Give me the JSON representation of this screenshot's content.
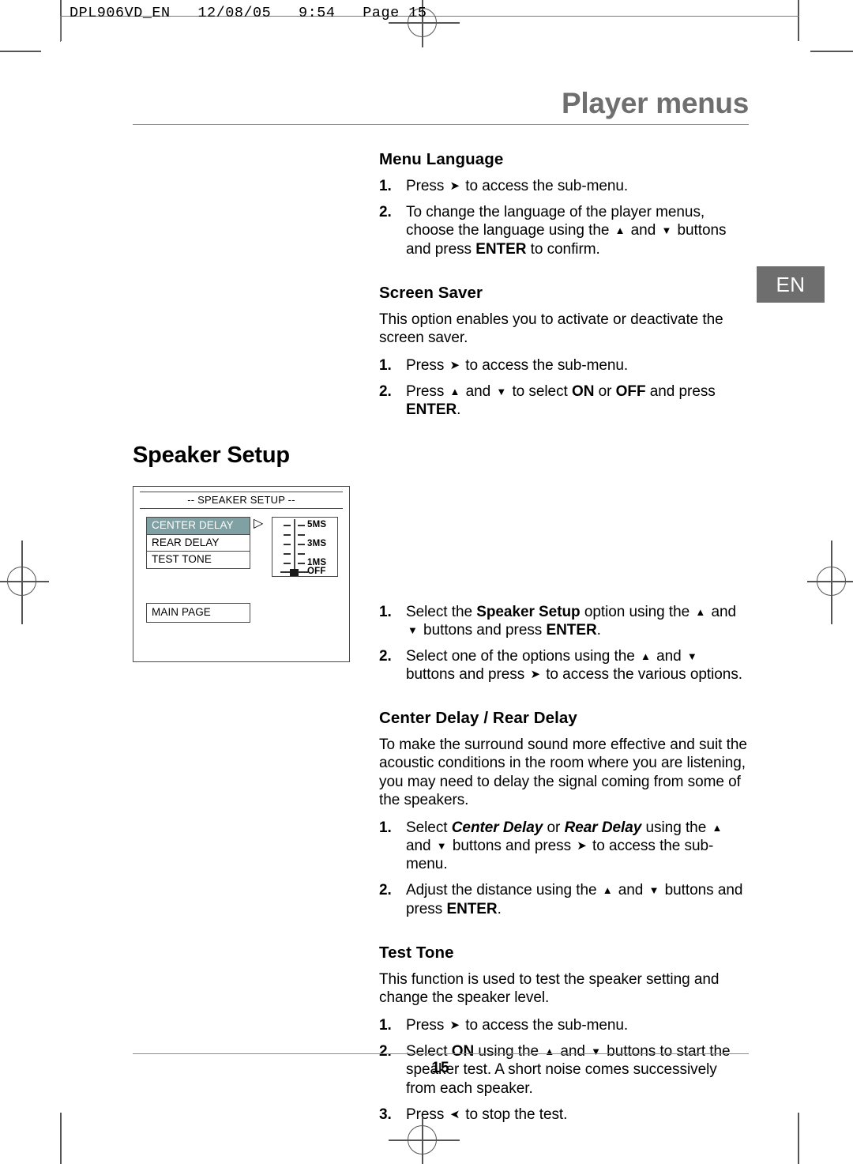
{
  "print_slug": "DPL906VD_EN   12/08/05   9:54   Page 15",
  "header": {
    "chapter_title": "Player menus"
  },
  "language_tab": {
    "label": "EN",
    "bg_color": "#6e6e6e",
    "text_color": "#ffffff"
  },
  "footer": {
    "page_number": "15"
  },
  "glyphs": {
    "right": "➤",
    "left": "➤",
    "up": "▲",
    "down": "▼"
  },
  "sections": {
    "menu_language": {
      "heading": "Menu Language",
      "steps": [
        {
          "num": "1.",
          "parts": [
            {
              "t": "Press ",
              "s": "n"
            },
            {
              "t": "right-arrow",
              "s": "arrow-right"
            },
            {
              "t": " to access the sub-menu.",
              "s": "n"
            }
          ]
        },
        {
          "num": "2.",
          "parts": [
            {
              "t": "To change the language of the player menus, choose the language using the ",
              "s": "n"
            },
            {
              "t": "up-arrow",
              "s": "arrow-up"
            },
            {
              "t": " and ",
              "s": "n"
            },
            {
              "t": "down-arrow",
              "s": "arrow-down"
            },
            {
              "t": " buttons and press ",
              "s": "n"
            },
            {
              "t": "ENTER",
              "s": "b"
            },
            {
              "t": " to confirm.",
              "s": "n"
            }
          ]
        }
      ]
    },
    "screen_saver": {
      "heading": "Screen Saver",
      "intro": "This option enables you to activate or deactivate the screen saver.",
      "steps": [
        {
          "num": "1.",
          "parts": [
            {
              "t": "Press ",
              "s": "n"
            },
            {
              "t": "right-arrow",
              "s": "arrow-right"
            },
            {
              "t": " to access the sub-menu.",
              "s": "n"
            }
          ]
        },
        {
          "num": "2.",
          "parts": [
            {
              "t": "Press ",
              "s": "n"
            },
            {
              "t": "up-arrow",
              "s": "arrow-up"
            },
            {
              "t": " and ",
              "s": "n"
            },
            {
              "t": "down-arrow",
              "s": "arrow-down"
            },
            {
              "t": " to select ",
              "s": "n"
            },
            {
              "t": "ON",
              "s": "b"
            },
            {
              "t": " or ",
              "s": "n"
            },
            {
              "t": "OFF",
              "s": "b"
            },
            {
              "t": " and press ",
              "s": "n"
            },
            {
              "t": "ENTER",
              "s": "b"
            },
            {
              "t": ".",
              "s": "n"
            }
          ]
        }
      ]
    },
    "speaker_setup": {
      "heading": "Speaker Setup",
      "steps": [
        {
          "num": "1.",
          "parts": [
            {
              "t": "Select the ",
              "s": "n"
            },
            {
              "t": "Speaker Setup",
              "s": "b"
            },
            {
              "t": " option using the ",
              "s": "n"
            },
            {
              "t": "up-arrow",
              "s": "arrow-up"
            },
            {
              "t": " and ",
              "s": "n"
            },
            {
              "t": "down-arrow",
              "s": "arrow-down"
            },
            {
              "t": " buttons and press ",
              "s": "n"
            },
            {
              "t": "ENTER",
              "s": "b"
            },
            {
              "t": ".",
              "s": "n"
            }
          ]
        },
        {
          "num": "2.",
          "parts": [
            {
              "t": "Select one of the options using the ",
              "s": "n"
            },
            {
              "t": "up-arrow",
              "s": "arrow-up"
            },
            {
              "t": " and ",
              "s": "n"
            },
            {
              "t": "down-arrow",
              "s": "arrow-down"
            },
            {
              "t": " buttons and press ",
              "s": "n"
            },
            {
              "t": "right-arrow",
              "s": "arrow-right"
            },
            {
              "t": " to access the various options.",
              "s": "n"
            }
          ]
        }
      ]
    },
    "center_rear_delay": {
      "heading": "Center Delay / Rear Delay",
      "intro": "To make the surround sound more effective and suit the acoustic conditions in the room where you are listening, you may need to delay the signal coming from some of the speakers.",
      "steps": [
        {
          "num": "1.",
          "parts": [
            {
              "t": "Select ",
              "s": "n"
            },
            {
              "t": "Center Delay",
              "s": "bi"
            },
            {
              "t": " or ",
              "s": "n"
            },
            {
              "t": "Rear Delay",
              "s": "bi"
            },
            {
              "t": " using the ",
              "s": "n"
            },
            {
              "t": "up-arrow",
              "s": "arrow-up"
            },
            {
              "t": " and ",
              "s": "n"
            },
            {
              "t": "down-arrow",
              "s": "arrow-down"
            },
            {
              "t": " buttons and press ",
              "s": "n"
            },
            {
              "t": "right-arrow",
              "s": "arrow-right"
            },
            {
              "t": " to access the sub-menu.",
              "s": "n"
            }
          ]
        },
        {
          "num": "2.",
          "parts": [
            {
              "t": "Adjust the distance using the ",
              "s": "n"
            },
            {
              "t": "up-arrow",
              "s": "arrow-up"
            },
            {
              "t": " and ",
              "s": "n"
            },
            {
              "t": "down-arrow",
              "s": "arrow-down"
            },
            {
              "t": " buttons and press ",
              "s": "n"
            },
            {
              "t": "ENTER",
              "s": "b"
            },
            {
              "t": ".",
              "s": "n"
            }
          ]
        }
      ]
    },
    "test_tone": {
      "heading": "Test Tone",
      "intro": "This function is used to test the speaker setting and change the speaker level.",
      "steps": [
        {
          "num": "1.",
          "parts": [
            {
              "t": "Press ",
              "s": "n"
            },
            {
              "t": "right-arrow",
              "s": "arrow-right"
            },
            {
              "t": " to access the sub-menu.",
              "s": "n"
            }
          ]
        },
        {
          "num": "2.",
          "parts": [
            {
              "t": "Select ",
              "s": "n"
            },
            {
              "t": "ON",
              "s": "b"
            },
            {
              "t": " using the ",
              "s": "n"
            },
            {
              "t": "up-arrow",
              "s": "arrow-up"
            },
            {
              "t": " and ",
              "s": "n"
            },
            {
              "t": "down-arrow",
              "s": "arrow-down"
            },
            {
              "t": " buttons to start the speaker test. A short noise comes successively from each speaker.",
              "s": "n"
            }
          ]
        },
        {
          "num": "3.",
          "parts": [
            {
              "t": "Press ",
              "s": "n"
            },
            {
              "t": "left-arrow",
              "s": "arrow-left"
            },
            {
              "t": " to stop the test.",
              "s": "n"
            }
          ]
        }
      ]
    }
  },
  "osd_screen": {
    "title": "-- SPEAKER SETUP --",
    "highlight_color": "#7fa1a4",
    "menu_items": [
      {
        "label": "CENTER DELAY",
        "selected": true
      },
      {
        "label": "REAR DELAY",
        "selected": false
      },
      {
        "label": "TEST TONE",
        "selected": false
      }
    ],
    "main_page_label": "MAIN PAGE",
    "slider": {
      "rows": [
        {
          "label": "5MS",
          "handle": false
        },
        {
          "label": "",
          "handle": false
        },
        {
          "label": "3MS",
          "handle": false
        },
        {
          "label": "",
          "handle": false
        },
        {
          "label": "1MS",
          "handle": false
        },
        {
          "label": "OFF",
          "handle": true
        }
      ],
      "selected_value": "OFF"
    }
  }
}
